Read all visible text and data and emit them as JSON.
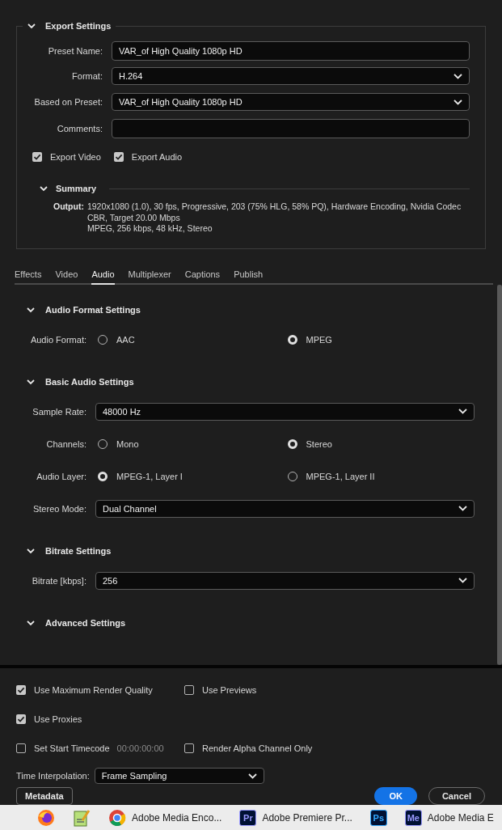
{
  "export_settings": {
    "title": "Export Settings",
    "expanded": true,
    "fields": [
      {
        "kind": "text",
        "label": "Preset Name:",
        "value": "VAR_of High Quality 1080p HD"
      },
      {
        "kind": "dropdown",
        "label": "Format:",
        "value": "H.264"
      },
      {
        "kind": "dropdown",
        "label": "Based on Preset:",
        "value": "VAR_of High Quality 1080p HD"
      },
      {
        "kind": "text",
        "label": "Comments:"
      }
    ],
    "checkboxes": [
      {
        "label": "Export Video",
        "checked": true
      },
      {
        "label": "Export Audio",
        "checked": true
      }
    ],
    "summary": {
      "title": "Summary",
      "expanded": true,
      "label": "Output:",
      "lines": [
        "1920x1080 (1.0), 30 fps, Progressive, 203 (75% HLG, 58% PQ), Hardware Encoding, Nvidia Codec",
        "CBR, Target 20.00 Mbps",
        "MPEG, 256 kbps, 48 kHz, Stereo"
      ]
    }
  },
  "tabs": [
    {
      "label": "Effects",
      "selected": false
    },
    {
      "label": "Video",
      "selected": false
    },
    {
      "label": "Audio",
      "selected": true
    },
    {
      "label": "Multiplexer",
      "selected": false
    },
    {
      "label": "Captions",
      "selected": false
    },
    {
      "label": "Publish",
      "selected": false
    }
  ],
  "sections": [
    {
      "title": "Audio Format Settings",
      "expanded": true,
      "rows": [
        {
          "kind": "radio",
          "label": "Audio Format:",
          "options": [
            {
              "label": "AAC",
              "selected": false
            },
            {
              "label": "MPEG",
              "selected": true
            }
          ]
        }
      ]
    },
    {
      "title": "Basic Audio Settings",
      "expanded": true,
      "rows": [
        {
          "kind": "dropdown",
          "label": "Sample Rate:",
          "value": "48000 Hz"
        },
        {
          "kind": "radio",
          "label": "Channels:",
          "options": [
            {
              "label": "Mono",
              "selected": false
            },
            {
              "label": "Stereo",
              "selected": true
            }
          ]
        },
        {
          "kind": "radio",
          "label": "Audio Layer:",
          "options": [
            {
              "label": "MPEG-1, Layer I",
              "selected": true
            },
            {
              "label": "MPEG-1, Layer II",
              "selected": false
            }
          ]
        },
        {
          "kind": "dropdown",
          "label": "Stereo Mode:",
          "value": "Dual Channel"
        }
      ]
    },
    {
      "title": "Bitrate Settings",
      "expanded": true,
      "rows": [
        {
          "kind": "dropdown",
          "label": "Bitrate [kbps]:",
          "value": "256"
        }
      ]
    },
    {
      "title": "Advanced Settings",
      "expanded": true
    }
  ],
  "render_options": [
    [
      {
        "label": "Use Maximum Render Quality",
        "checked": true
      },
      {
        "label": "Use Previews",
        "checked": false
      }
    ],
    [
      {
        "label": "Use Proxies",
        "checked": true
      }
    ],
    [
      {
        "label": "Set Start Timecode",
        "checked": false,
        "value": "00:00:00:00"
      },
      {
        "label": "Render Alpha Channel Only",
        "checked": false
      }
    ]
  ],
  "time_interpolation": {
    "label": "Time Interpolation:",
    "value": "Frame Sampling"
  },
  "buttons": [
    {
      "label": "Metadata",
      "kind": "secondary"
    },
    {
      "label": "OK",
      "kind": "primary"
    },
    {
      "label": "Cancel",
      "kind": "secondary"
    }
  ],
  "taskbar": {
    "items": [
      {
        "kind": "fox"
      },
      {
        "kind": "notepad"
      },
      {
        "kind": "wheel",
        "label": "Adobe Media Enco..."
      },
      {
        "kind": "badge",
        "badge": "Pr",
        "color": "#9999ff",
        "label": "Adobe Premiere Pr..."
      },
      {
        "kind": "badge",
        "badge": "Ps",
        "color": "#31a8ff"
      },
      {
        "kind": "badge",
        "badge": "Me",
        "color": "#9999ff",
        "label": "Adobe Media E"
      }
    ]
  }
}
